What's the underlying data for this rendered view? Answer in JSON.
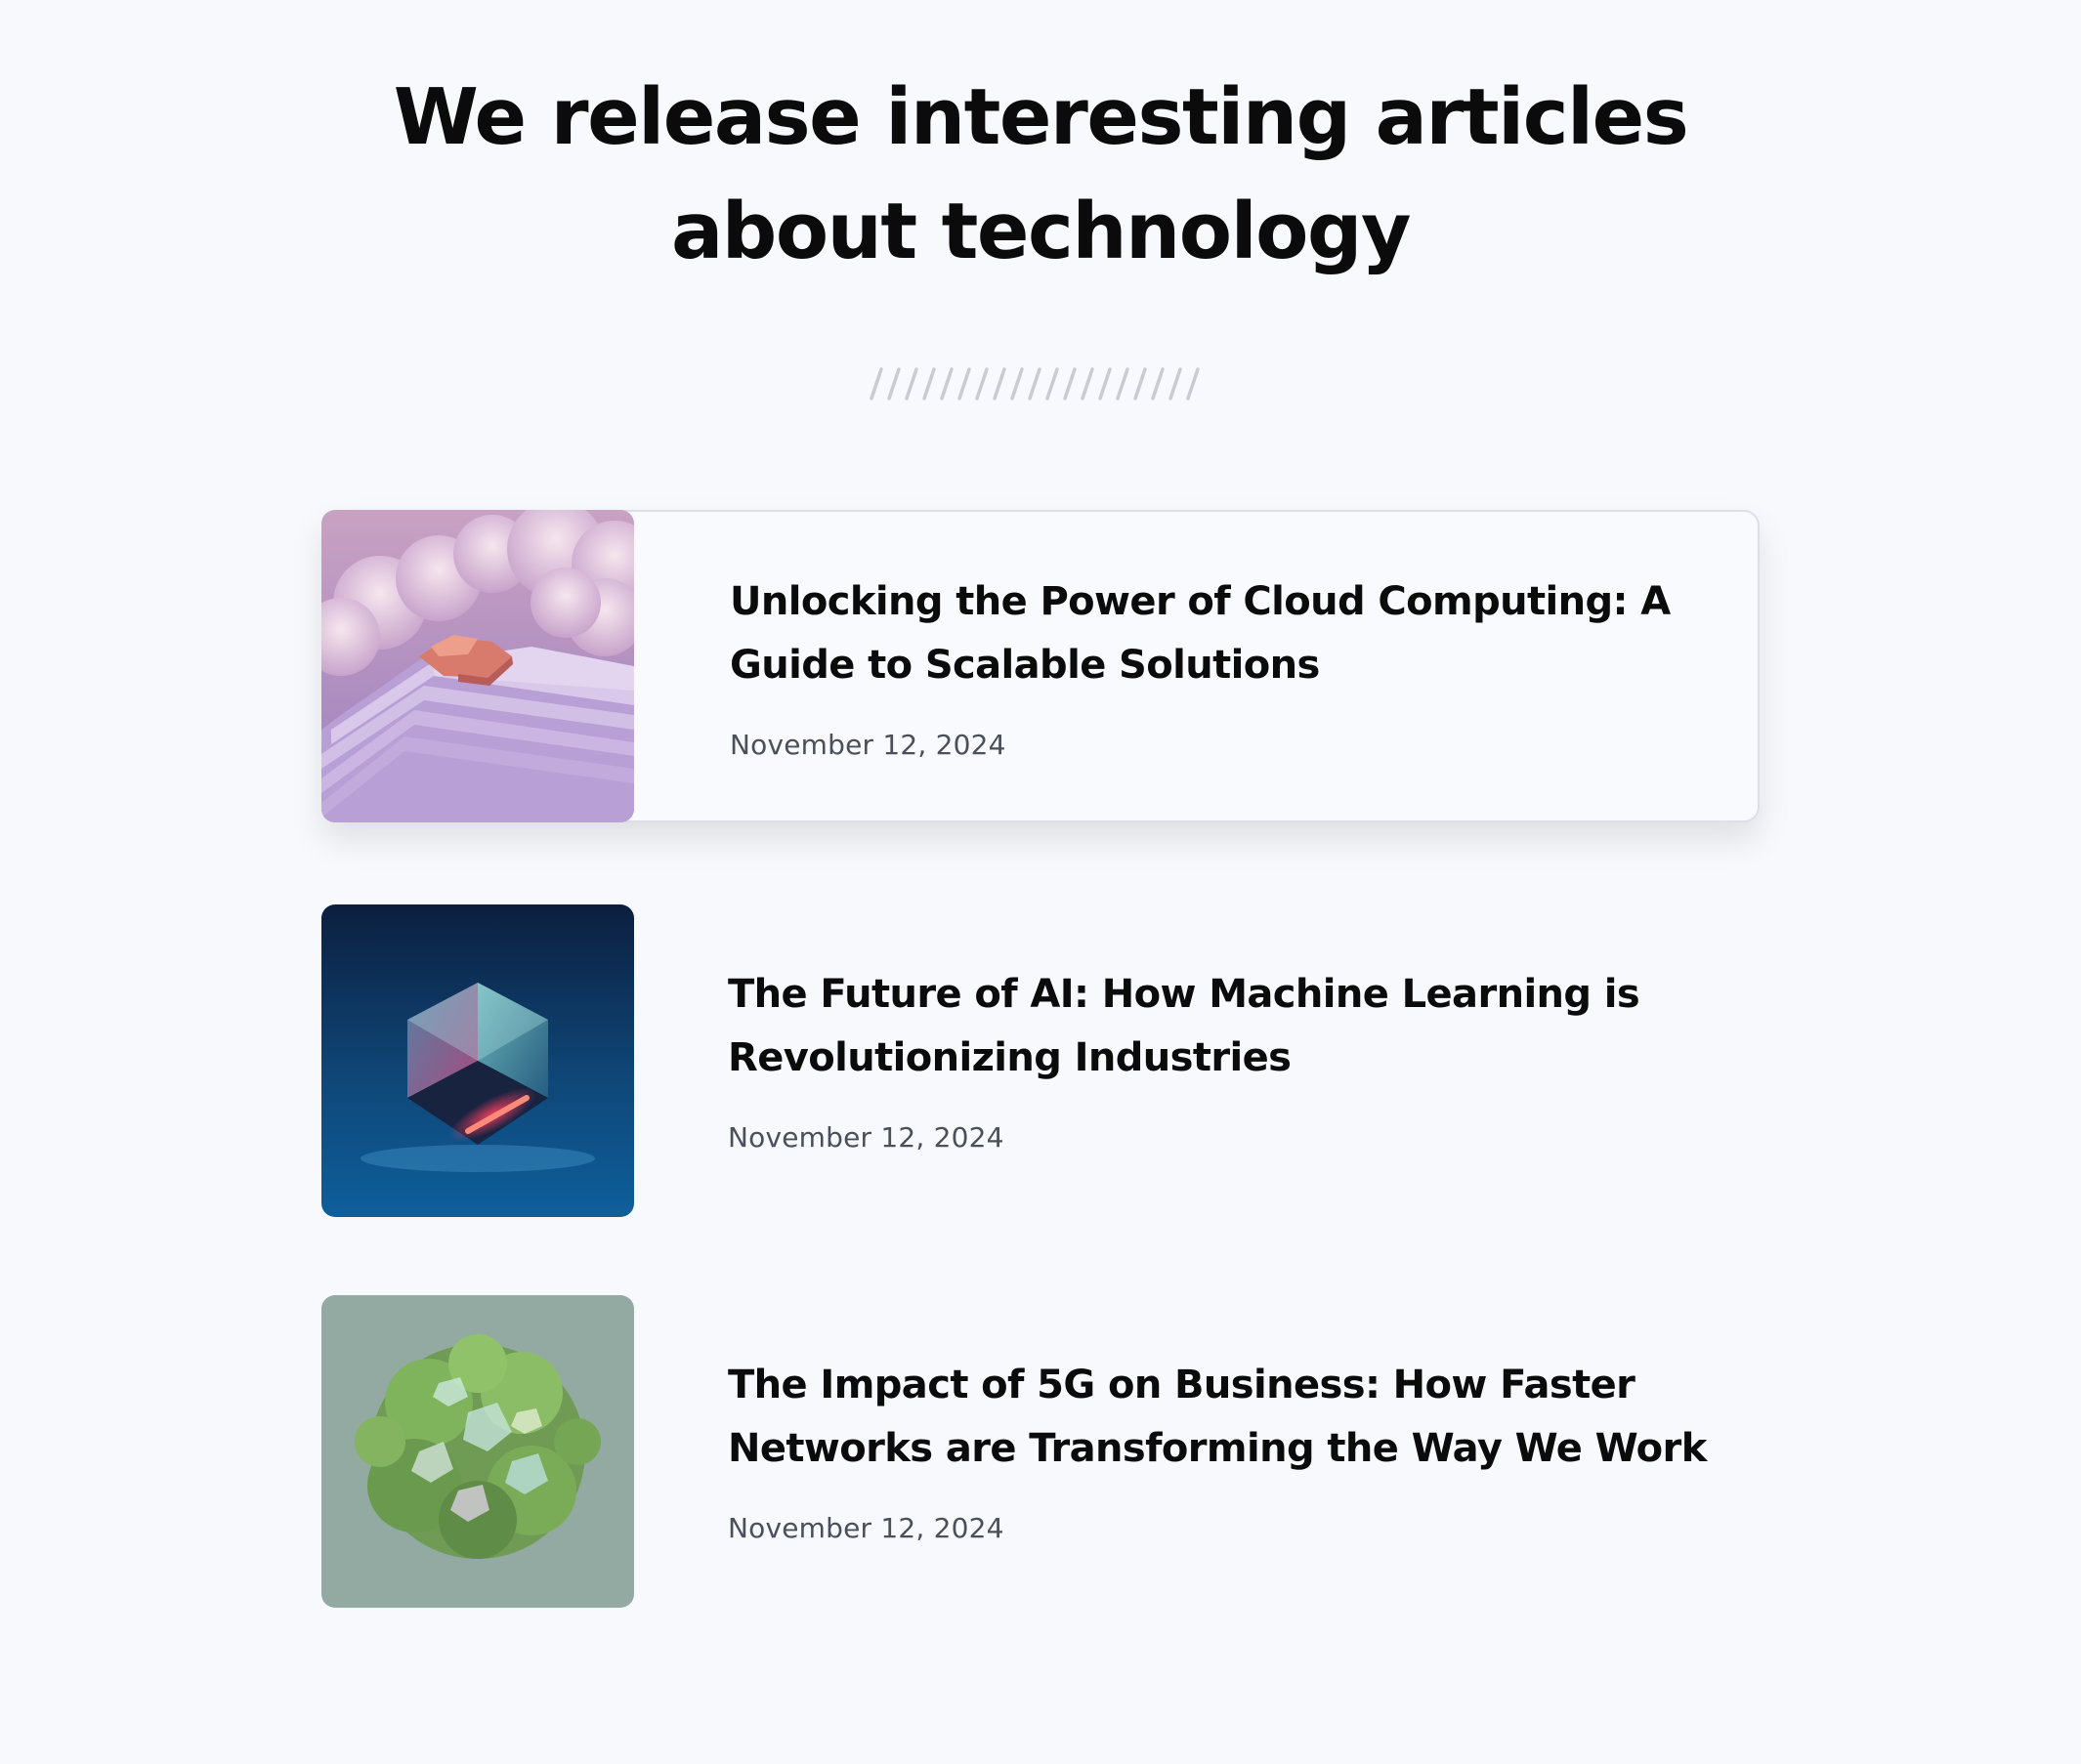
{
  "section": {
    "title": "We release interesting articles about technology"
  },
  "articles": [
    {
      "title": "Unlocking the Power of Cloud Computing: A Guide to Scalable Solutions",
      "date": "November 12, 2024"
    },
    {
      "title": "The Future of AI: How Machine Learning is Revolutionizing Industries",
      "date": "November 12, 2024"
    },
    {
      "title": "The Impact of 5G on Business: How Faster Networks are Transforming the Way We Work",
      "date": "November 12, 2024"
    }
  ],
  "colors": {
    "background": "#f8f9fd",
    "text": "#0b0b0b",
    "date_text": "#4a4f5a",
    "divider": "#c9cbd0",
    "card_border": "#dcdfe6"
  }
}
